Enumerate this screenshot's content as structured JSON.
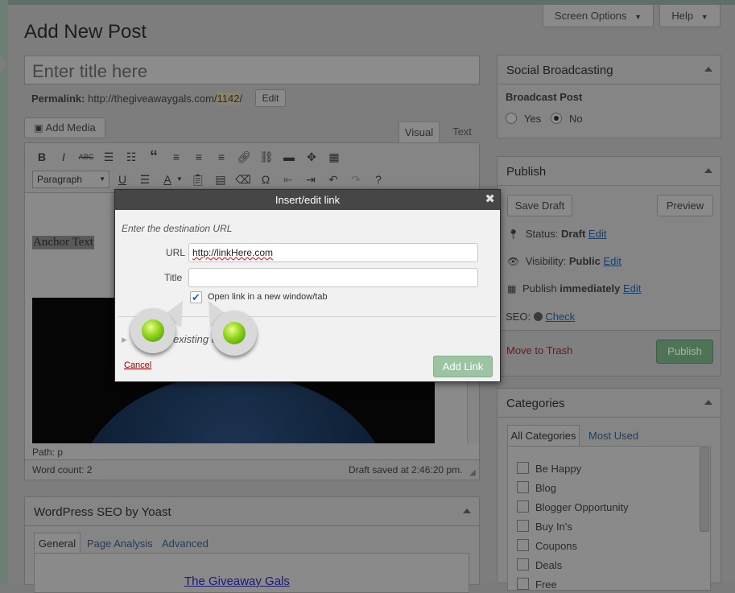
{
  "header": {
    "page_title": "Add New Post",
    "screen_options_label": "Screen Options",
    "help_label": "Help"
  },
  "editor": {
    "title_placeholder": "Enter title here",
    "permalink_label": "Permalink:",
    "permalink_url": "http://thegiveawaygals.com/",
    "permalink_slug": "1142",
    "permalink_tail": "/",
    "permalink_edit": "Edit",
    "add_media_label": "Add Media",
    "tab_visual": "Visual",
    "tab_text": "Text",
    "format_select": "Paragraph",
    "anchor_text": "Anchor Text",
    "path_label": "Path: p",
    "word_count": "Word count: 2",
    "draft_saved": "Draft saved at 2:46:20 pm."
  },
  "seo_panel": {
    "title": "WordPress SEO by Yoast",
    "tabs": [
      "General",
      "Page Analysis",
      "Advanced"
    ],
    "preview_title": "The Giveaway Gals"
  },
  "social": {
    "title": "Social Broadcasting",
    "broadcast_label": "Broadcast Post",
    "yes": "Yes",
    "no": "No"
  },
  "publish": {
    "title": "Publish",
    "save_draft": "Save Draft",
    "preview": "Preview",
    "status_label": "Status:",
    "status_value": "Draft",
    "visibility_label": "Visibility:",
    "visibility_value": "Public",
    "publish_label": "Publish",
    "publish_value": "immediately",
    "edit": "Edit",
    "seo_label": "SEO:",
    "seo_check": "Check",
    "move_to_trash": "Move to Trash",
    "publish_button": "Publish"
  },
  "categories": {
    "title": "Categories",
    "tab_all": "All Categories",
    "tab_most_used": "Most Used",
    "items": [
      "Be Happy",
      "Blog",
      "Blogger Opportunity",
      "Buy In's",
      "Coupons",
      "Deals",
      "Free"
    ]
  },
  "link_dialog": {
    "title": "Insert/edit link",
    "instruction": "Enter the destination URL",
    "url_label": "URL",
    "url_value": "http://linkHere.com",
    "title_label": "Title",
    "title_value": "",
    "new_window_label": "Open link in a new window/tab",
    "existing_content_partial": "existing c",
    "cancel": "Cancel",
    "add_link": "Add Link"
  },
  "colors": {
    "dialog_header": "#464646",
    "add_link_button": "#9cc4a3",
    "cancel_link": "#a00000",
    "callout_green": "#8ed31a"
  }
}
